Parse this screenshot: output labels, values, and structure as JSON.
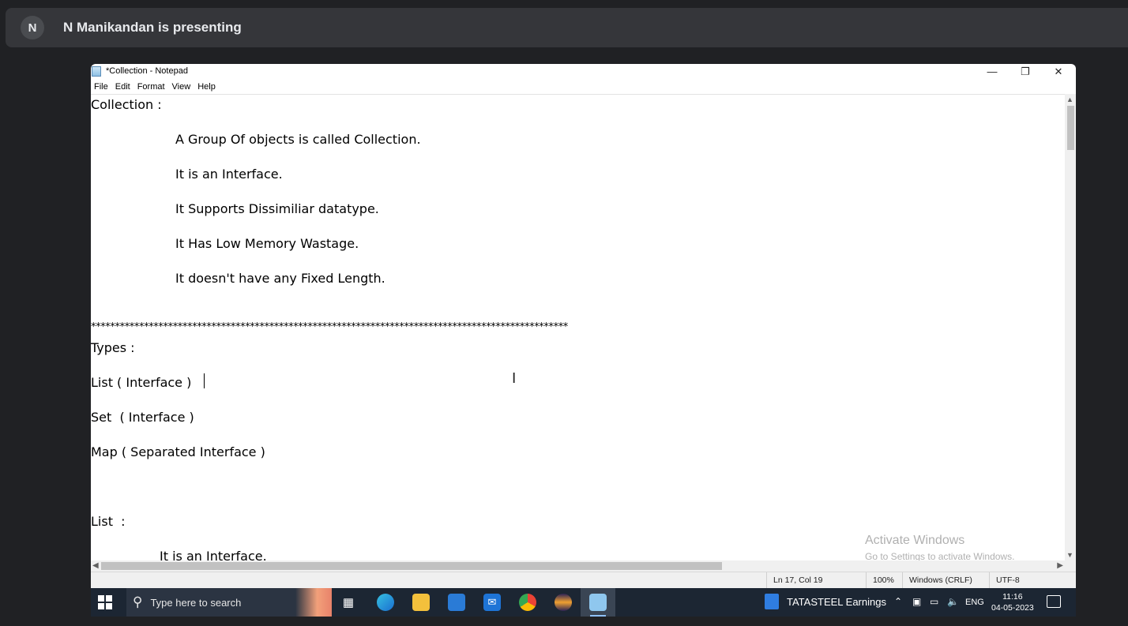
{
  "meet": {
    "avatar_letter": "N",
    "presenting_text": "N Manikandan is presenting"
  },
  "notepad": {
    "window_title": "*Collection - Notepad",
    "window_controls": {
      "minimize": "—",
      "restore": "❐",
      "close": "✕"
    },
    "menu": [
      "File",
      "Edit",
      "Format",
      "View",
      "Help"
    ],
    "lines": [
      {
        "text": "Collection :",
        "indent": 0
      },
      {
        "text": "A Group Of objects is called Collection.",
        "indent": 2
      },
      {
        "text": "It is an Interface.",
        "indent": 2
      },
      {
        "text": "It Supports Dissimiliar datatype.",
        "indent": 2
      },
      {
        "text": "It Has Low Memory Wastage.",
        "indent": 2
      },
      {
        "text": "It doesn't have any Fixed Length.",
        "indent": 2
      },
      {
        "text": "***************************************************************************************************",
        "indent": 0
      },
      {
        "text": "Types :",
        "indent": 0
      },
      {
        "text": "List ( Interface )",
        "indent": 0
      },
      {
        "text": "Set  ( Interface )",
        "indent": 0
      },
      {
        "text": "Map ( Separated Interface )",
        "indent": 0
      },
      {
        "text": "List  :",
        "indent": 0
      },
      {
        "text": "It is an Interface.",
        "indent": 1
      }
    ],
    "status": {
      "position": "Ln 17, Col 19",
      "zoom": "100%",
      "line_ending": "Windows (CRLF)",
      "encoding": "UTF-8"
    },
    "watermark": {
      "title": "Activate Windows",
      "subtitle": "Go to Settings to activate Windows."
    }
  },
  "taskbar": {
    "search_placeholder": "Type here to search",
    "news": "TATASTEEL  Earnings",
    "language": "ENG",
    "time": "11:16",
    "date": "04-05-2023"
  }
}
